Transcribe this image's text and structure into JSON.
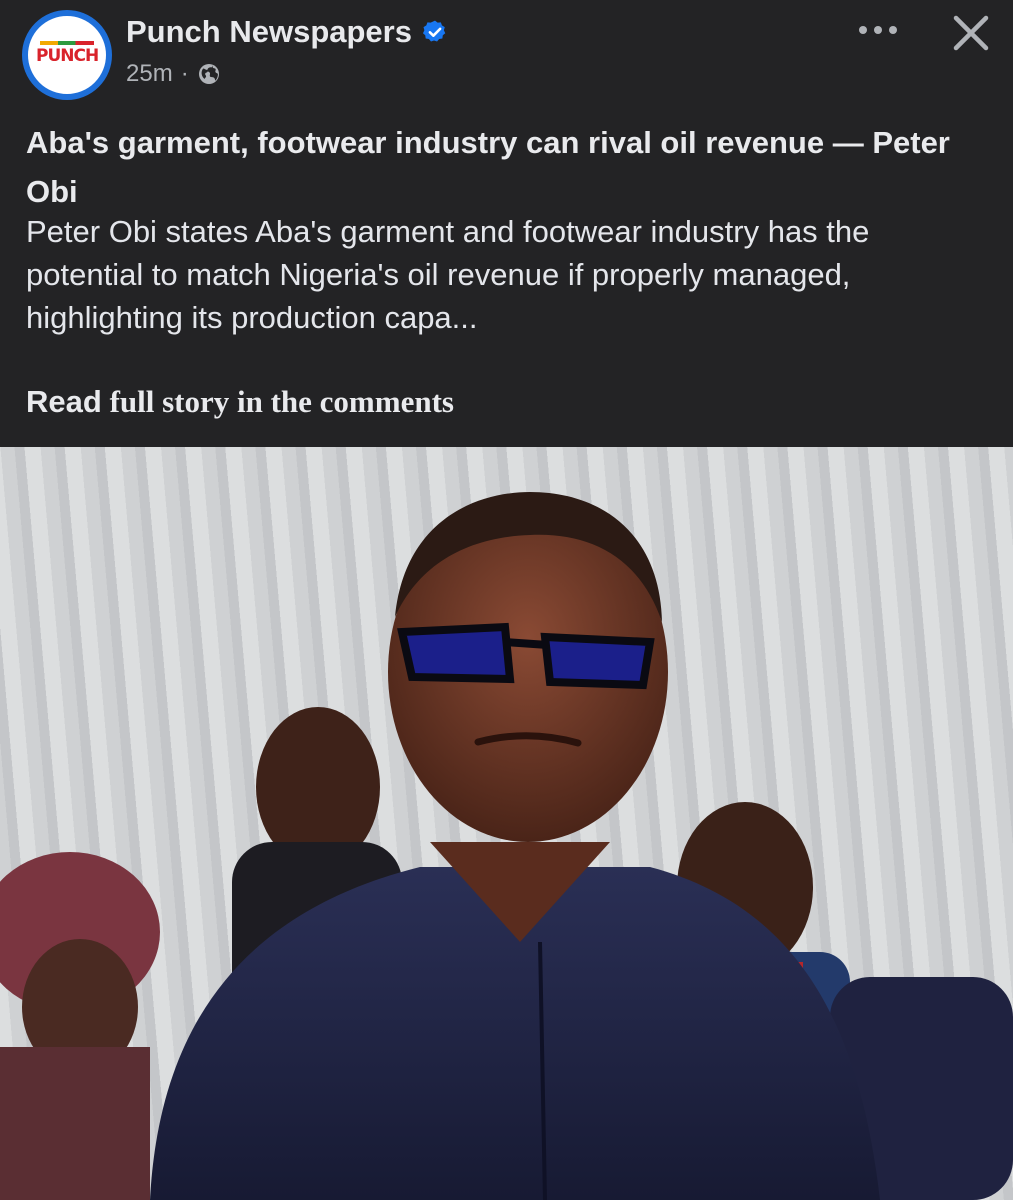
{
  "post": {
    "page_name": "Punch Newspapers",
    "logo_text": "PUNCH",
    "timestamp": "25m",
    "meta_separator": "·",
    "audience_icon": "globe-icon",
    "verified_icon": "verified-badge-icon",
    "more_icon": "more-options-icon",
    "close_icon": "close-icon",
    "headline": "Aba's garment, footwear industry can rival oil revenue — Peter Obi",
    "summary": " Peter Obi states Aba's garment and footwear industry has the potential to match Nigeria's oil revenue if properly managed, highlighting its production capa...",
    "read_more_a": "Read",
    "read_more_b": " full story in the comments"
  },
  "colors": {
    "background": "#232325",
    "verified_blue": "#1877f2",
    "avatar_ring": "#1e6fd9",
    "logo_red": "#d9232b"
  }
}
